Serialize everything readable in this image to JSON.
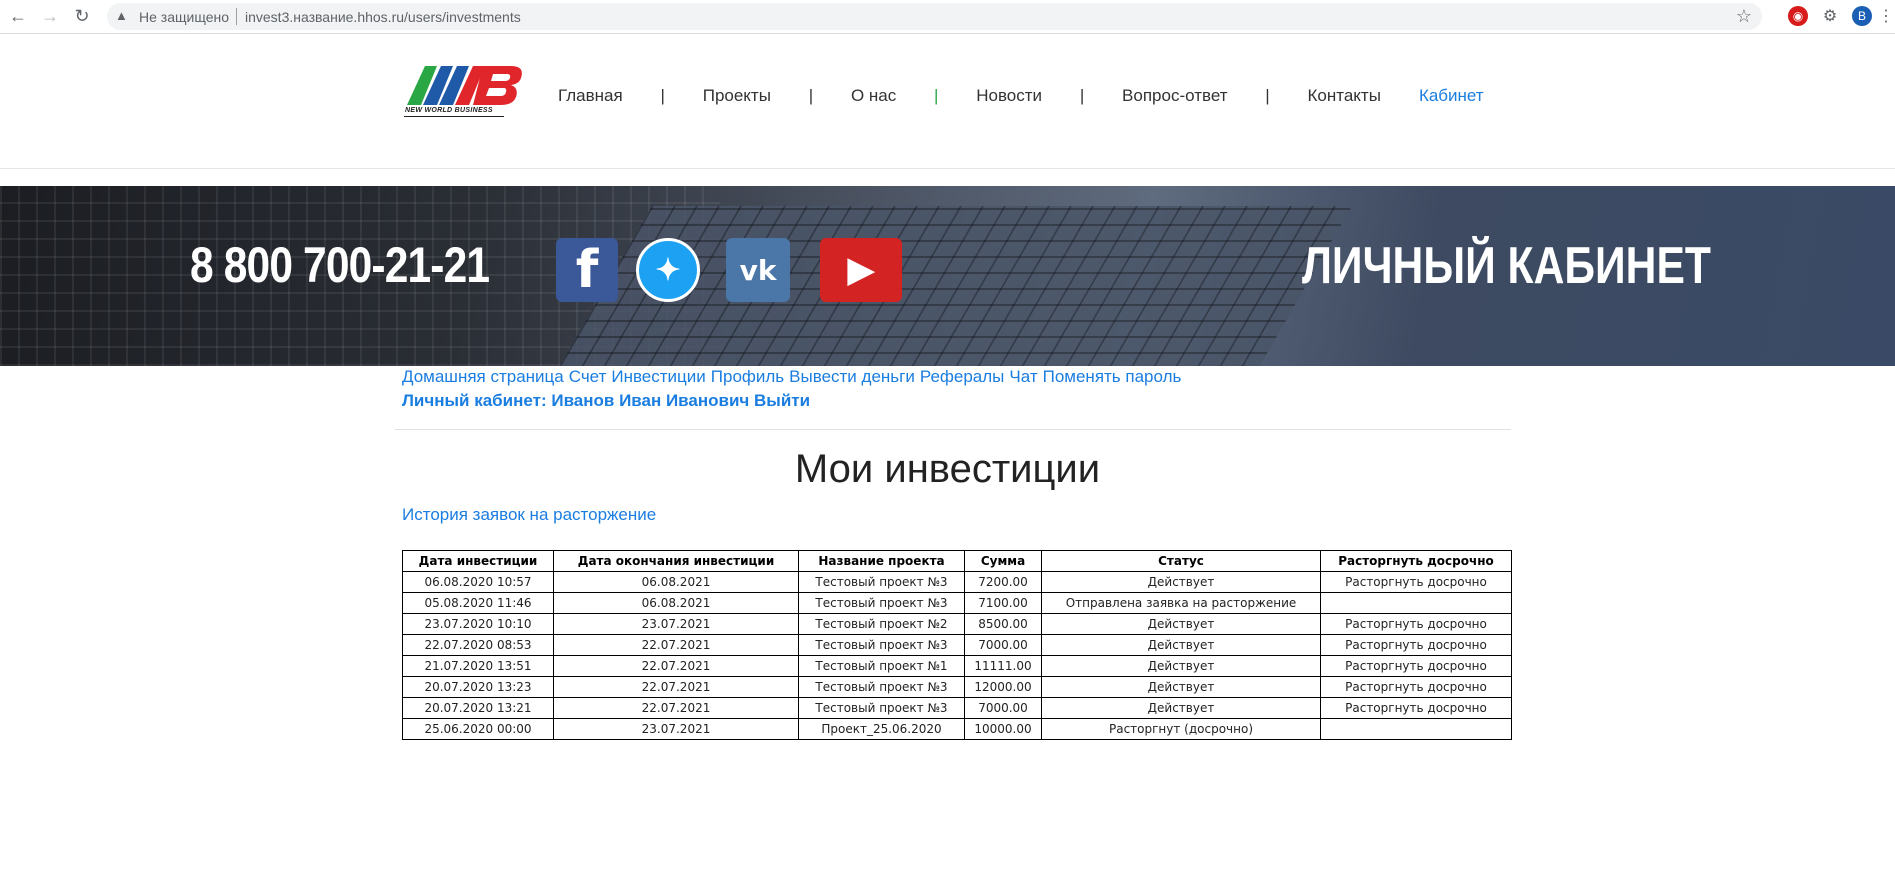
{
  "browser": {
    "security": "Не защищено",
    "url": "invest3.название.hhos.ru/users/investments",
    "avatar_letter": "B"
  },
  "header": {
    "logo_text": "NEW WORLD BUSINESS",
    "nav": [
      {
        "label": "Главная"
      },
      {
        "label": "Проекты"
      },
      {
        "label": "О нас"
      },
      {
        "label": "Новости"
      },
      {
        "label": "Вопрос-ответ"
      },
      {
        "label": "Контакты"
      },
      {
        "label": "Кабинет"
      }
    ],
    "separator": "|"
  },
  "banner": {
    "phone": "8 800 700-21-21",
    "title": "ЛИЧНЫЙ КАБИНЕТ",
    "social": [
      "facebook-icon",
      "twitter-icon",
      "vk-icon",
      "youtube-icon"
    ]
  },
  "account_nav": {
    "links": [
      "Домашняя страница",
      "Счет",
      "Инвестиции",
      "Профиль",
      "Вывести деньги",
      "Рефералы",
      "Чат",
      "Поменять пароль"
    ],
    "user_prefix": "Личный кабинет:",
    "user_name": "Иванов Иван Иванович",
    "logout": "Выйти"
  },
  "page": {
    "title": "Мои инвестиции",
    "history_link": "История заявок на расторжение"
  },
  "table": {
    "headers": [
      "Дата инвестиции",
      "Дата окончания инвестиции",
      "Название проекта",
      "Сумма",
      "Статус",
      "Расторгнуть досрочно"
    ],
    "rows": [
      {
        "date": "06.08.2020 10:57",
        "end": "06.08.2021",
        "project": "Тестовый проект №3",
        "sum": "7200.00",
        "status": "Действует",
        "action": "Расторгнуть досрочно"
      },
      {
        "date": "05.08.2020 11:46",
        "end": "06.08.2021",
        "project": "Тестовый проект №3",
        "sum": "7100.00",
        "status": "Отправлена заявка на расторжение",
        "action": ""
      },
      {
        "date": "23.07.2020 10:10",
        "end": "23.07.2021",
        "project": "Тестовый проект №2",
        "sum": "8500.00",
        "status": "Действует",
        "action": "Расторгнуть досрочно"
      },
      {
        "date": "22.07.2020 08:53",
        "end": "22.07.2021",
        "project": "Тестовый проект №3",
        "sum": "7000.00",
        "status": "Действует",
        "action": "Расторгнуть досрочно"
      },
      {
        "date": "21.07.2020 13:51",
        "end": "22.07.2021",
        "project": "Тестовый проект №1",
        "sum": "11111.00",
        "status": "Действует",
        "action": "Расторгнуть досрочно"
      },
      {
        "date": "20.07.2020 13:23",
        "end": "22.07.2021",
        "project": "Тестовый проект №3",
        "sum": "12000.00",
        "status": "Действует",
        "action": "Расторгнуть досрочно"
      },
      {
        "date": "20.07.2020 13:21",
        "end": "22.07.2021",
        "project": "Тестовый проект №3",
        "sum": "7000.00",
        "status": "Действует",
        "action": "Расторгнуть досрочно"
      },
      {
        "date": "25.06.2020 00:00",
        "end": "23.07.2021",
        "project": "Проект_25.06.2020",
        "sum": "10000.00",
        "status": "Расторгнут (досрочно)",
        "action": "",
        "status_color": "#e02020"
      }
    ]
  },
  "colors": {
    "link": "#1a7de0",
    "cancelled": "#e02020"
  }
}
